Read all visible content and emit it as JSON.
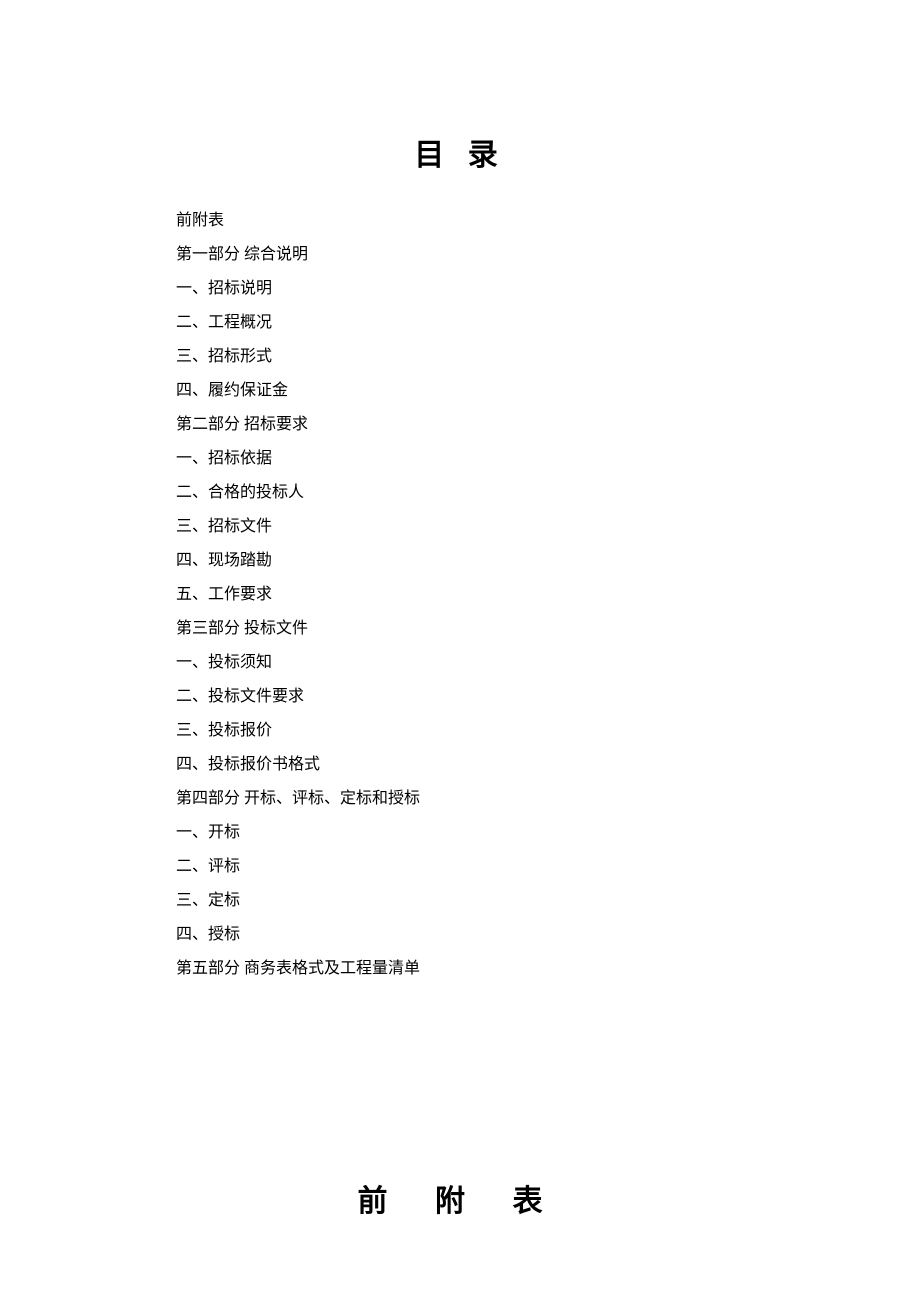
{
  "title": "目 录",
  "subtitle": "前  附  表",
  "toc": [
    "前附表",
    "第一部分  综合说明",
    "一、招标说明",
    "二、工程概况",
    "三、招标形式",
    "四、履约保证金",
    "第二部分  招标要求",
    "一、招标依据",
    "二、合格的投标人",
    "三、招标文件",
    "四、现场踏勘",
    "五、工作要求",
    "第三部分  投标文件",
    "一、投标须知",
    "二、投标文件要求",
    "三、投标报价",
    "四、投标报价书格式",
    "第四部分  开标、评标、定标和授标",
    "一、开标",
    "二、评标",
    "三、定标",
    "四、授标",
    "第五部分  商务表格式及工程量清单"
  ]
}
